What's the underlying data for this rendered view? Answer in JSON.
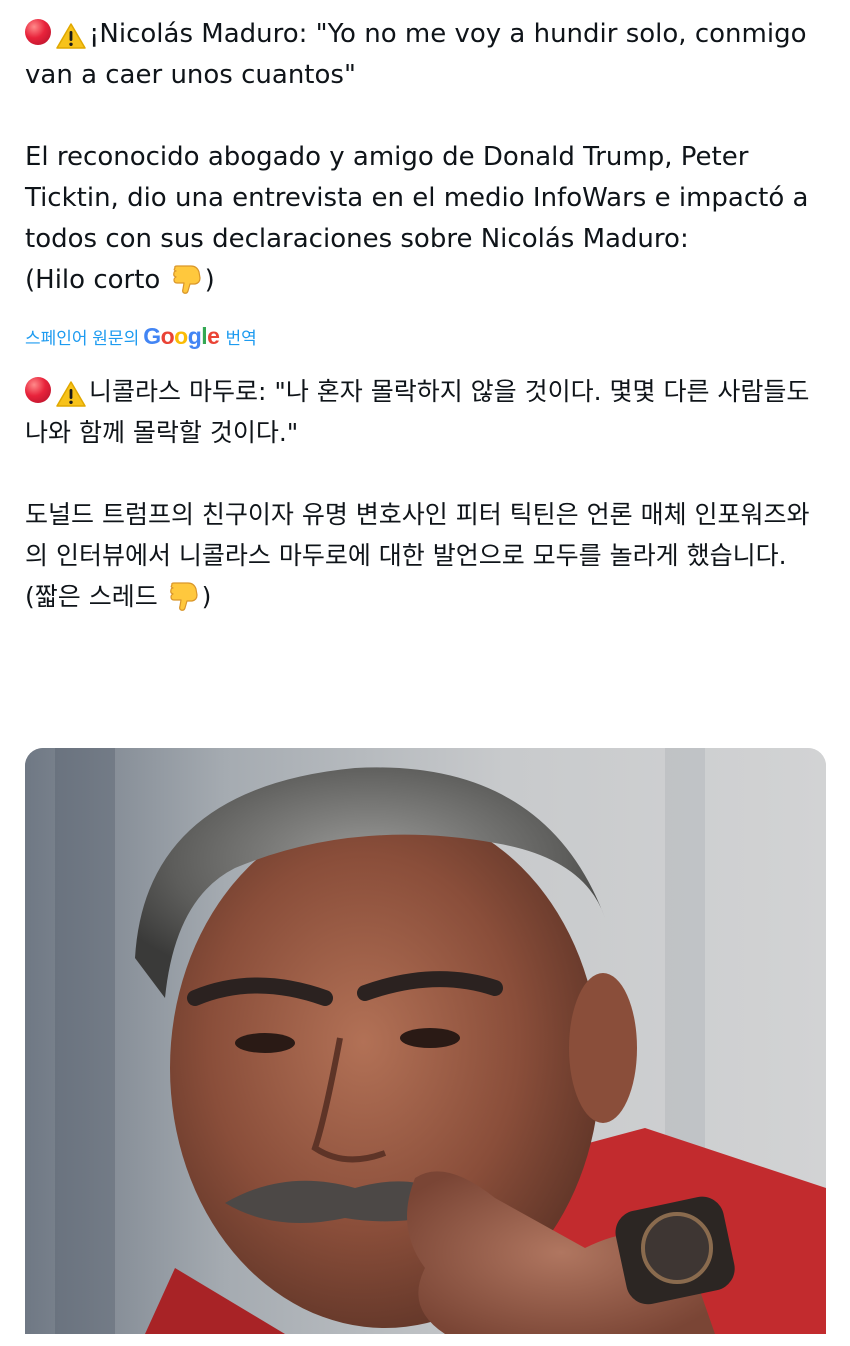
{
  "tweet": {
    "original": {
      "headline": "¡Nicolás Maduro: \"Yo no me voy a hundir solo, conmigo van a caer unos cuantos\"",
      "body": "El reconocido abogado y amigo de Donald Trump, Peter Ticktin, dio una entrevista en el medio InfoWars e impactó a todos con sus declaraciones sobre Nicolás Maduro:",
      "thread_note_prefix": "(Hilo corto ",
      "thread_note_suffix": ")"
    },
    "translate_bar": {
      "prefix": "스페인어 원문의",
      "brand": "Google",
      "suffix": "번역"
    },
    "translated": {
      "headline": "니콜라스 마두로: \"나 혼자 몰락하지 않을 것이다. 몇몇 다른 사람들도 나와 함께 몰락할 것이다.\"",
      "body": "도널드 트럼프의 친구이자 유명 변호사인 피터 틱틴은 언론 매체 인포워즈와의 인터뷰에서 니콜라스 마두로에 대한 발언으로 모두를 놀라게 했습니다.",
      "thread_note_prefix": "(짧은 스레드 ",
      "thread_note_suffix": ")"
    },
    "emojis": [
      "red-circle",
      "warning",
      "backhand-index-pointing-down"
    ],
    "colors": {
      "link_blue": "#1d9bf0",
      "text": "#0f1419"
    }
  }
}
